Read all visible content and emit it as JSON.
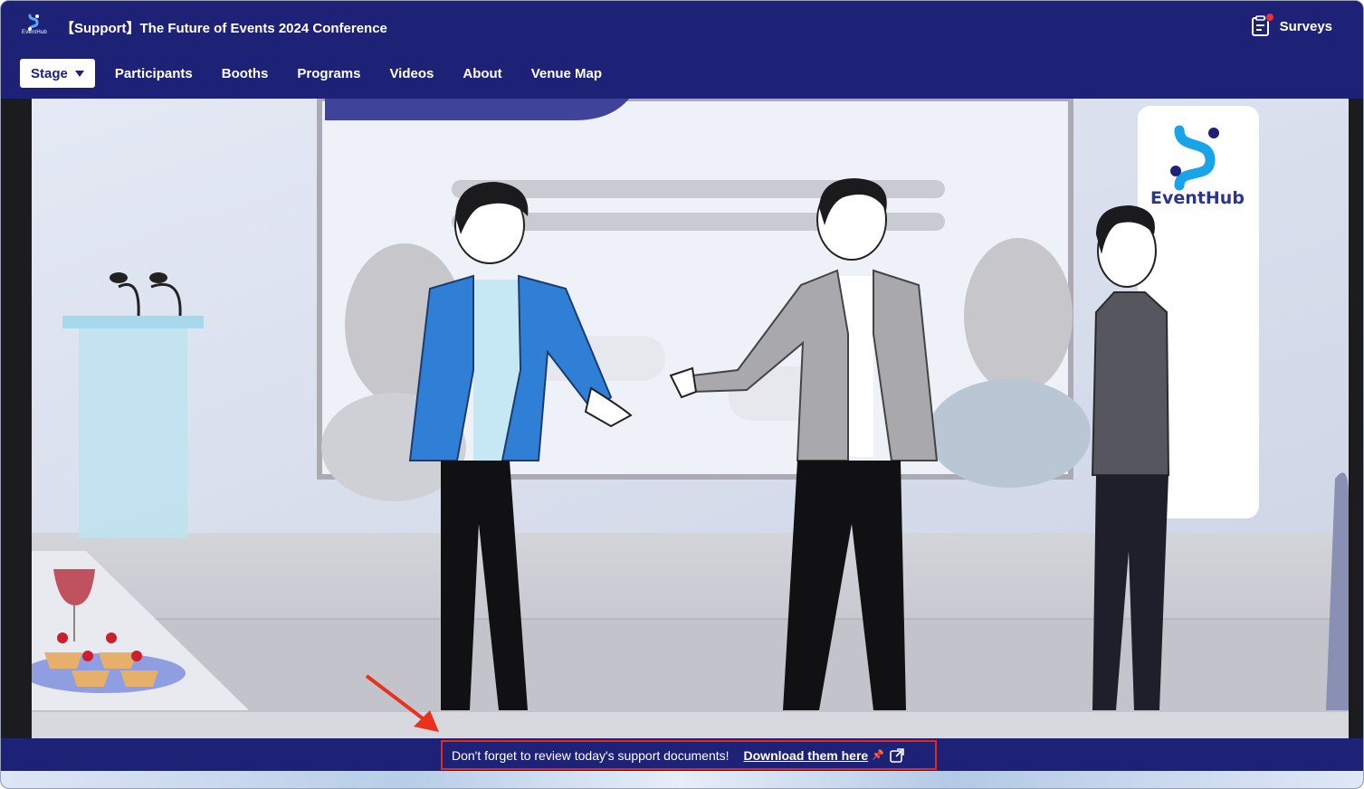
{
  "header": {
    "logo_text": "EventHub",
    "title": "【Support】The Future of Events 2024 Conference",
    "surveys_label": "Surveys",
    "surveys_icon": "clipboard-icon"
  },
  "nav": {
    "active": "Stage",
    "items": [
      "Participants",
      "Booths",
      "Programs",
      "Videos",
      "About",
      "Venue Map"
    ]
  },
  "stage": {
    "sign_brand": "EventHub"
  },
  "notice": {
    "text": "Don't forget to review today's support documents!",
    "link_label": "Download them here",
    "link_icon": "external-link-icon"
  },
  "colors": {
    "brand_navy": "#1d2277",
    "highlight_red": "#e02a1e",
    "jacket_blue": "#2f7fd6"
  }
}
